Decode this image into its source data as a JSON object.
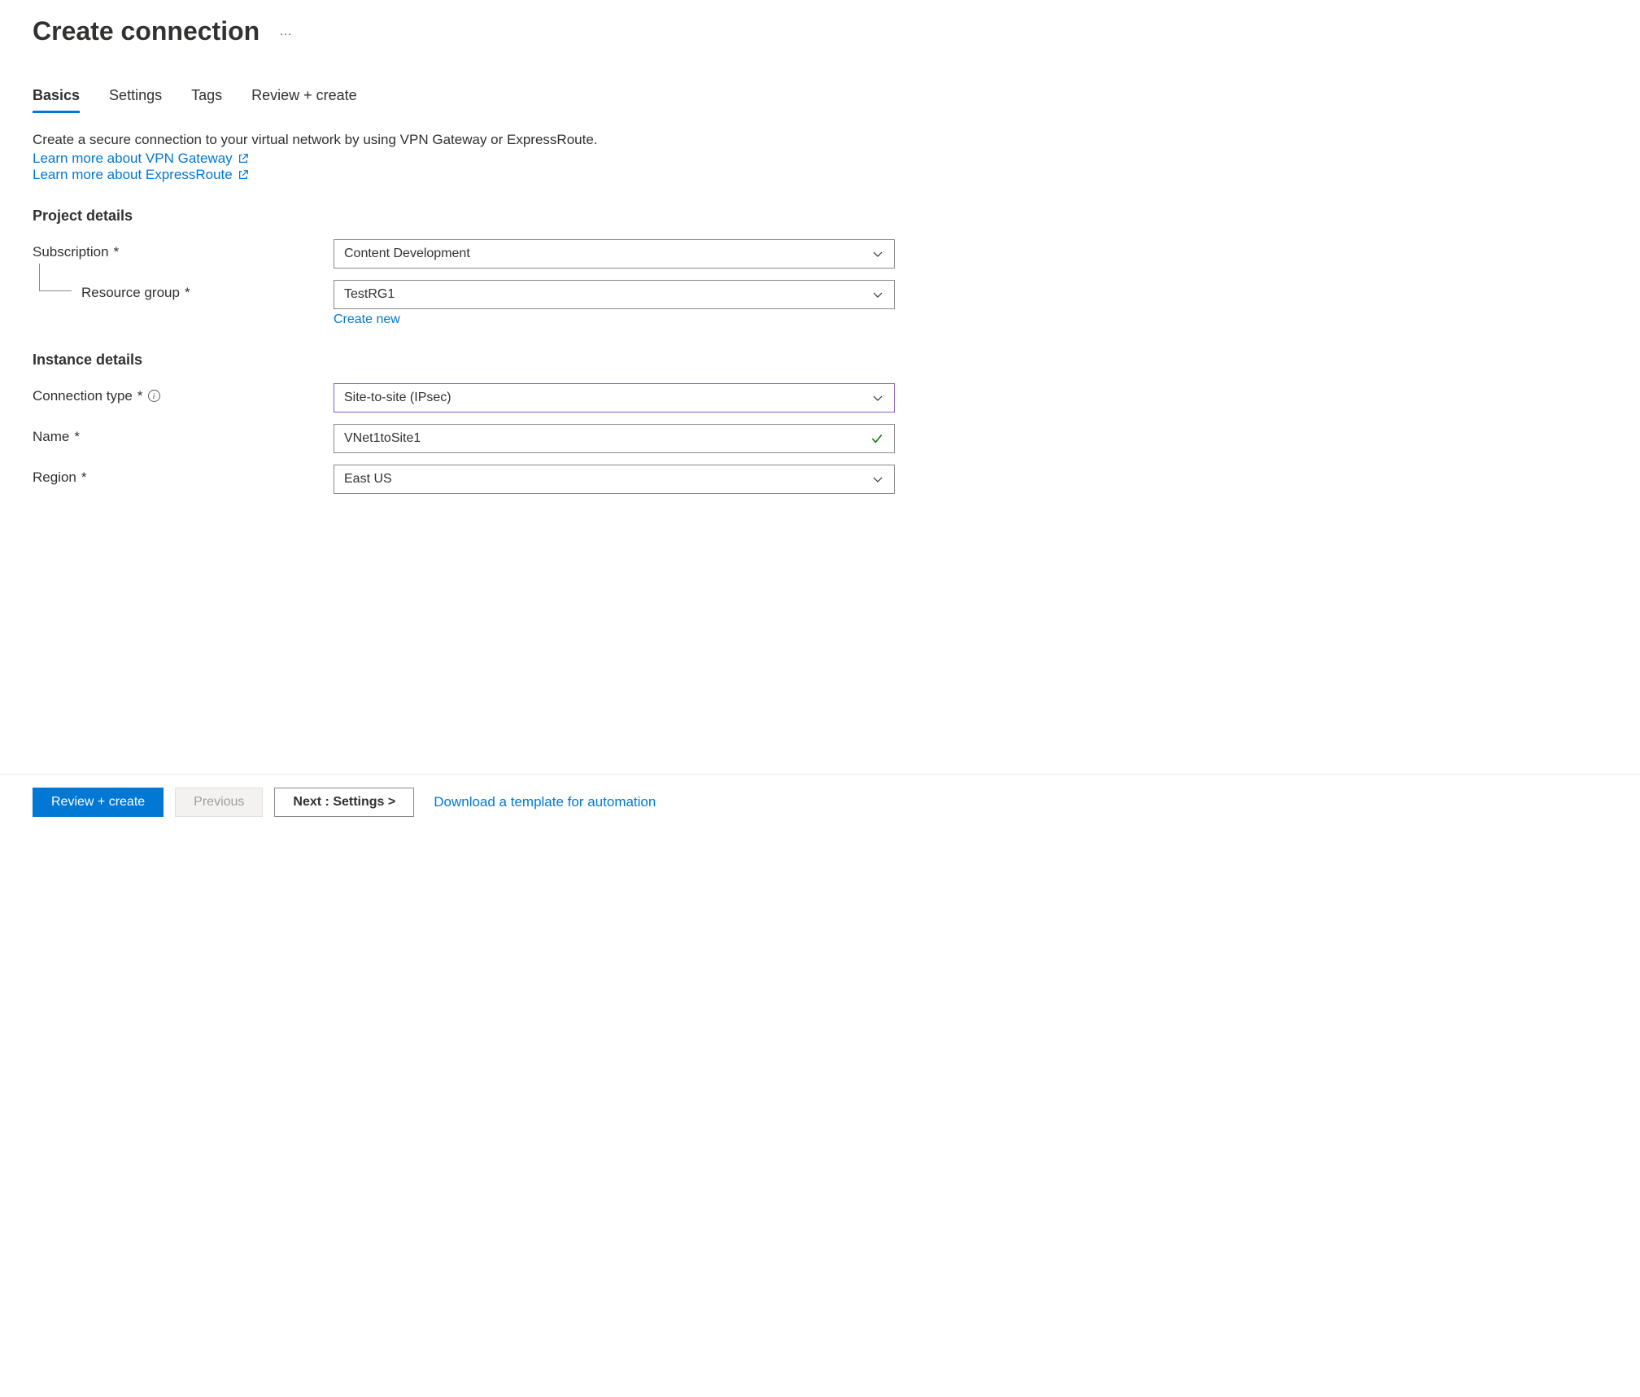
{
  "header": {
    "title": "Create connection"
  },
  "tabs": {
    "basics": "Basics",
    "settings": "Settings",
    "tags": "Tags",
    "review": "Review + create"
  },
  "intro": {
    "text": "Create a secure connection to your virtual network by using VPN Gateway or ExpressRoute.",
    "vpn_link": "Learn more about VPN Gateway",
    "er_link": "Learn more about ExpressRoute"
  },
  "sections": {
    "project": "Project details",
    "instance": "Instance details"
  },
  "fields": {
    "subscription": {
      "label": "Subscription",
      "value": "Content Development"
    },
    "resource_group": {
      "label": "Resource group",
      "value": "TestRG1",
      "create_new": "Create new"
    },
    "connection_type": {
      "label": "Connection type",
      "value": "Site-to-site (IPsec)"
    },
    "name": {
      "label": "Name",
      "value": "VNet1toSite1"
    },
    "region": {
      "label": "Region",
      "value": "East US"
    }
  },
  "footer": {
    "review": "Review + create",
    "previous": "Previous",
    "next": "Next : Settings >",
    "download": "Download a template for automation"
  }
}
